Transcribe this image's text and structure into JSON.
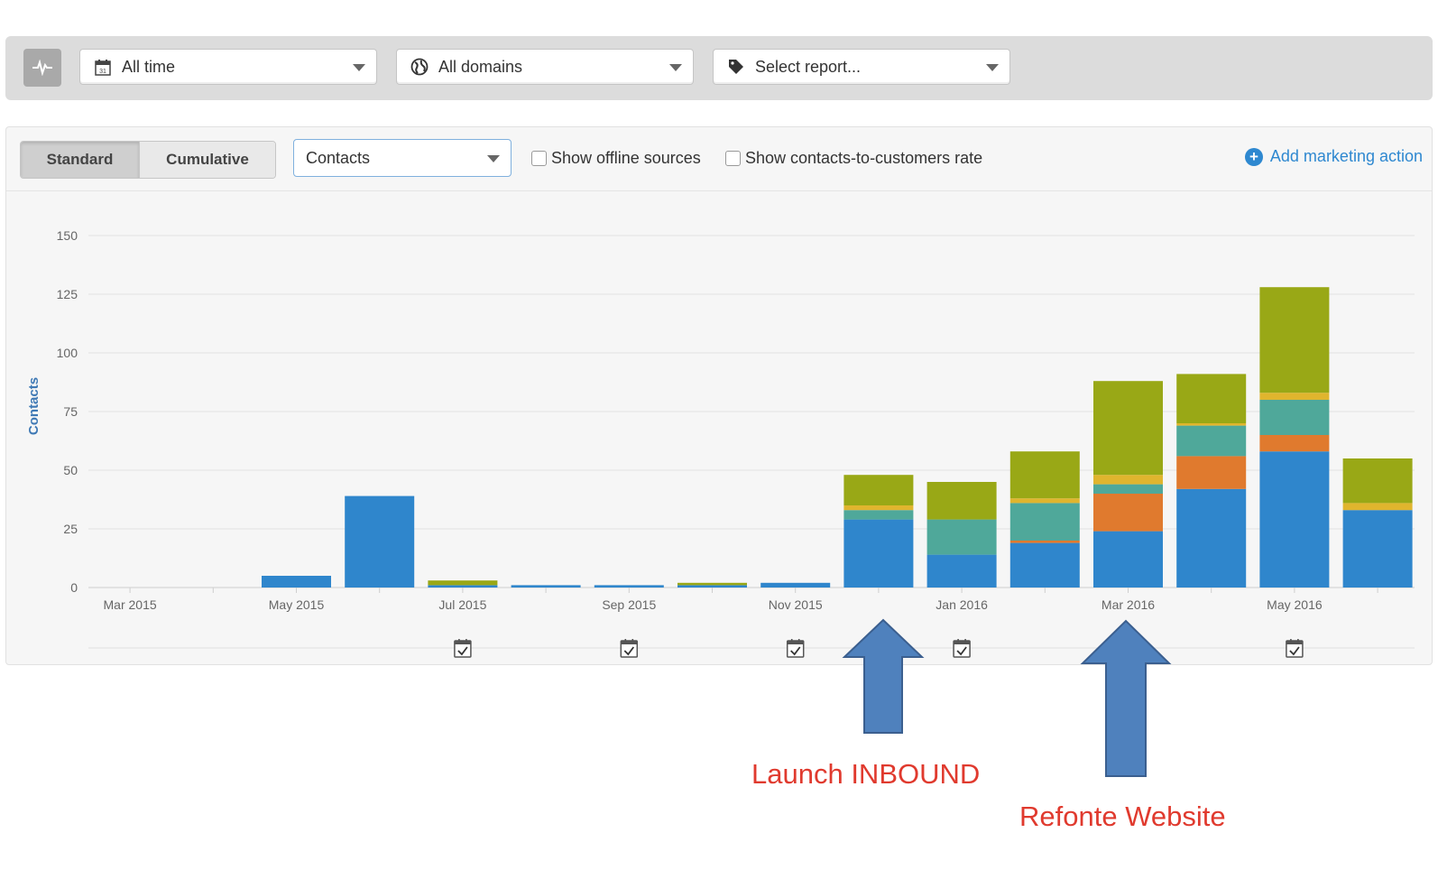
{
  "filters": {
    "date": "All time",
    "domains": "All domains",
    "report": "Select report..."
  },
  "controls": {
    "standard": "Standard",
    "cumulative": "Cumulative",
    "metric": "Contacts",
    "offline": "Show offline sources",
    "rate": "Show contacts-to-customers rate",
    "add_action": "Add marketing action"
  },
  "annotations": {
    "launch": "Launch INBOUND",
    "refonte": "Refonte Website"
  },
  "colors": {
    "blue": "#2f86cc",
    "orange": "#e07a2e",
    "teal": "#4fa89a",
    "yellow": "#e0b52e",
    "olive": "#99a816",
    "arrow": "#4f81bd",
    "annotation_text": "#e03a2e"
  },
  "chart_data": {
    "type": "bar",
    "stacked": true,
    "ylabel": "Contacts",
    "ylim": [
      0,
      150
    ],
    "yticks": [
      0,
      25,
      50,
      75,
      100,
      125,
      150
    ],
    "categories": [
      "Mar 2015",
      "Apr 2015",
      "May 2015",
      "Jun 2015",
      "Jul 2015",
      "Aug 2015",
      "Sep 2015",
      "Oct 2015",
      "Nov 2015",
      "Dec 2015",
      "Jan 2016",
      "Feb 2016",
      "Mar 2016",
      "Apr 2016",
      "May 2016",
      "Jun 2016"
    ],
    "xtick_labels": [
      "Mar 2015",
      "",
      "May 2015",
      "",
      "Jul 2015",
      "",
      "Sep 2015",
      "",
      "Nov 2015",
      "",
      "Jan 2016",
      "",
      "Mar 2016",
      "",
      "May 2016",
      ""
    ],
    "series": [
      {
        "color": "#2f86cc",
        "values": [
          0,
          0,
          5,
          39,
          1,
          1,
          1,
          1,
          2,
          29,
          14,
          19,
          24,
          42,
          58,
          33
        ]
      },
      {
        "color": "#e07a2e",
        "values": [
          0,
          0,
          0,
          0,
          0,
          0,
          0,
          0,
          0,
          0,
          0,
          1,
          16,
          14,
          7,
          0
        ]
      },
      {
        "color": "#4fa89a",
        "values": [
          0,
          0,
          0,
          0,
          0,
          0,
          0,
          0,
          0,
          4,
          15,
          16,
          4,
          13,
          15,
          0
        ]
      },
      {
        "color": "#e0b52e",
        "values": [
          0,
          0,
          0,
          0,
          0,
          0,
          0,
          0,
          0,
          2,
          0,
          2,
          4,
          1,
          3,
          3
        ]
      },
      {
        "color": "#99a816",
        "values": [
          0,
          0,
          0,
          0,
          2,
          0,
          0,
          1,
          0,
          13,
          16,
          20,
          40,
          21,
          45,
          19
        ]
      }
    ],
    "event_markers": [
      "Jul 2015",
      "Sep 2015",
      "Nov 2015",
      "Jan 2016",
      "May 2016"
    ],
    "grid": true
  }
}
